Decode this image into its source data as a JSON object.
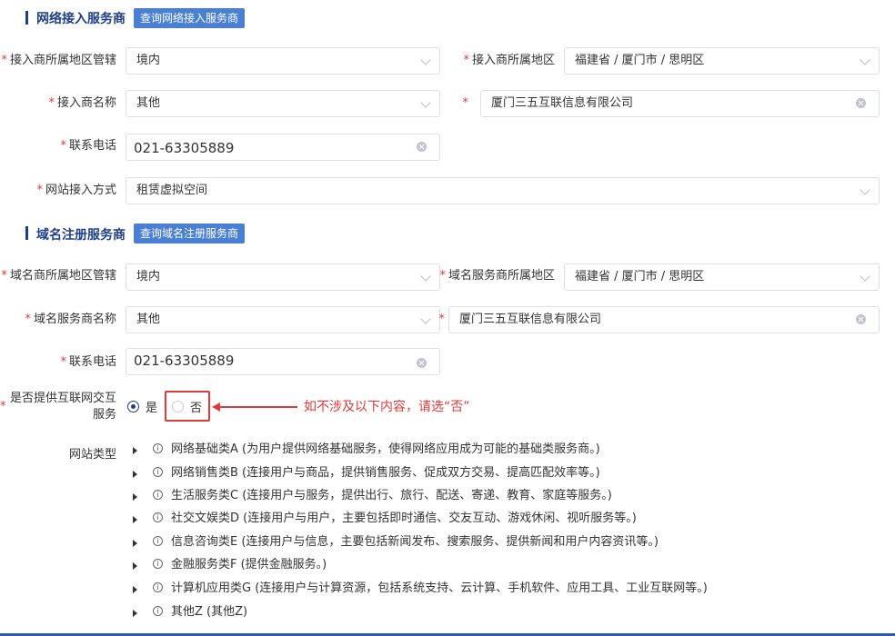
{
  "isp": {
    "title": "网络接入服务商",
    "query_button": "查询网络接入服务商",
    "region_label": "接入商所属地区管辖",
    "region_value": "境内",
    "area_label": "接入商所属地区",
    "area_value": "福建省 / 厦门市 / 思明区",
    "name_label": "接入商名称",
    "name_value": "其他",
    "company_value": "厦门三五互联信息有限公司",
    "phone_label": "联系电话",
    "phone_value": "021-63305889",
    "access_label": "网站接入方式",
    "access_value": "租赁虚拟空间"
  },
  "domain": {
    "title": "域名注册服务商",
    "query_button": "查询域名注册服务商",
    "region_label": "域名商所属地区管辖",
    "region_value": "境内",
    "area_label": "域名服务商所属地区",
    "area_value": "福建省 / 厦门市 / 思明区",
    "name_label": "域名服务商名称",
    "name_value": "其他",
    "company_value": "厦门三五互联信息有限公司",
    "phone_label": "联系电话",
    "phone_value": "021-63305889"
  },
  "interactive": {
    "label_line1": "是否提供互联网交互",
    "label_line2": "服务",
    "yes": "是",
    "no": "否",
    "selected": "是",
    "annotation": "如不涉及以下内容，请选“否”"
  },
  "site_types": {
    "label": "网站类型",
    "items": [
      "网络基础类A (为用户提供网络基础服务，使得网络应用成为可能的基础类服务商。)",
      "网络销售类B (连接用户与商品，提供销售服务、促成双方交易、提高匹配效率等。)",
      "生活服务类C (连接用户与服务，提供出行、旅行、配送、寄递、教育、家庭等服务。)",
      "社交文娱类D (连接用户与用户，主要包括即时通信、交友互动、游戏休闲、视听服务等。)",
      "信息咨询类E (连接用户与信息，主要包括新闻发布、搜索服务、提供新闻和用户内容资讯等。)",
      "金融服务类F (提供金融服务。)",
      "计算机应用类G (连接用户与计算资源，包括系统支持、云计算、手机软件、应用工具、工业互联网等。)",
      "其他Z (其他Z)"
    ]
  },
  "colors": {
    "accent": "#1f3f87",
    "button": "#4a7fd6",
    "required": "#e03a3a",
    "annotation": "#e03a3a"
  }
}
